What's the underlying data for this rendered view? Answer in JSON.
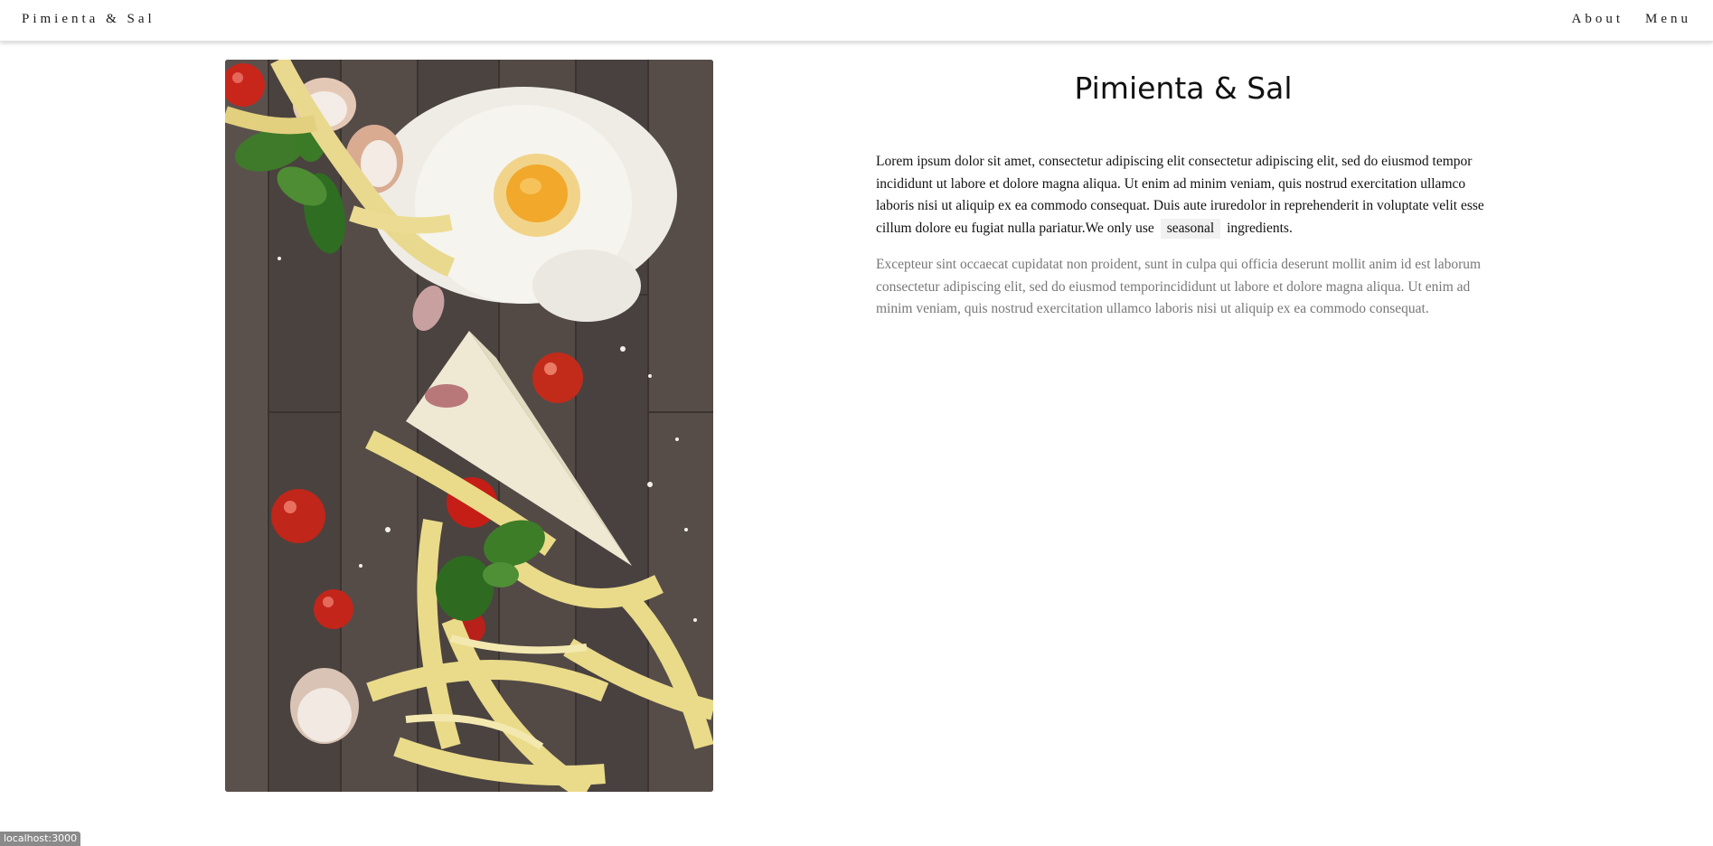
{
  "header": {
    "brand": "Pimienta & Sal",
    "nav": [
      {
        "label": "About"
      },
      {
        "label": "Menu"
      }
    ]
  },
  "hero_image": {
    "alt": "Pimienta & Sal"
  },
  "main": {
    "title": "Pimienta & Sal",
    "paragraph1": {
      "text": "Lorem ipsum dolor sit amet, consectetur adipiscing elit consectetur adipiscing elit, sed do eiusmod tempor incididunt ut labore et dolore magna aliqua. Ut enim ad minim veniam, quis nostrud exercitation ullamco laboris nisi ut aliquip ex ea commodo consequat. Duis aute iruredolor in reprehenderit in voluptate velit esse cillum dolore eu fugiat nulla pariatur.We only use",
      "tag": "seasonal",
      "suffix": "ingredients."
    },
    "paragraph2": "Excepteur sint occaecat cupidatat non proident, sunt in culpa qui officia deserunt mollit anim id est laborum consectetur adipiscing elit, sed do eiusmod temporincididunt ut labore et dolore magna aliqua. Ut enim ad minim veniam, quis nostrud exercitation ullamco laboris nisi ut aliquip ex ea commodo consequat."
  },
  "status_bar": {
    "url": "localhost:3000"
  },
  "colors": {
    "text": "#111111",
    "muted_text": "#777777",
    "tag_background": "#f1f1f1",
    "wood": "#4e4744"
  }
}
